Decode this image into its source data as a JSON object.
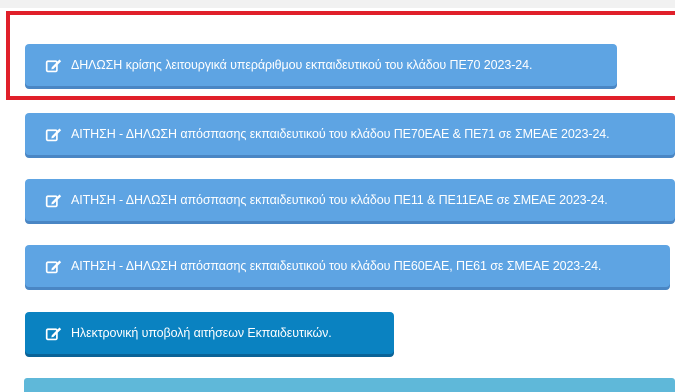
{
  "buttons": [
    {
      "label": "ΔΗΛΩΣΗ κρίσης λειτουργικά υπεράριθμου εκπαιδευτικού του κλάδου ΠΕ70 2023-24.",
      "icon": "edit-icon"
    },
    {
      "label": "ΑΙΤΗΣΗ - ΔΗΛΩΣΗ απόσπασης εκπαιδευτικού του κλάδου ΠΕ70ΕΑΕ & ΠΕ71 σε ΣΜΕΑΕ 2023-24.",
      "icon": "edit-icon"
    },
    {
      "label": "ΑΙΤΗΣΗ - ΔΗΛΩΣΗ απόσπασης εκπαιδευτικού του κλάδου ΠΕ11 & ΠΕ11ΕΑΕ σε ΣΜΕΑΕ 2023-24.",
      "icon": "edit-icon"
    },
    {
      "label": "ΑΙΤΗΣΗ - ΔΗΛΩΣΗ απόσπασης εκπαιδευτικού του κλάδου ΠΕ60ΕΑΕ, ΠΕ61 σε ΣΜΕΑΕ 2023-24.",
      "icon": "edit-icon"
    },
    {
      "label": "Ηλεκτρονική υποβολή αιτήσεων Εκπαιδευτικών.",
      "icon": "edit-icon"
    }
  ],
  "colors": {
    "button_light": "#5ea4e3",
    "button_dark": "#0a82c1",
    "highlight": "#e0202a",
    "bottom_bar": "#5fb8d9"
  }
}
